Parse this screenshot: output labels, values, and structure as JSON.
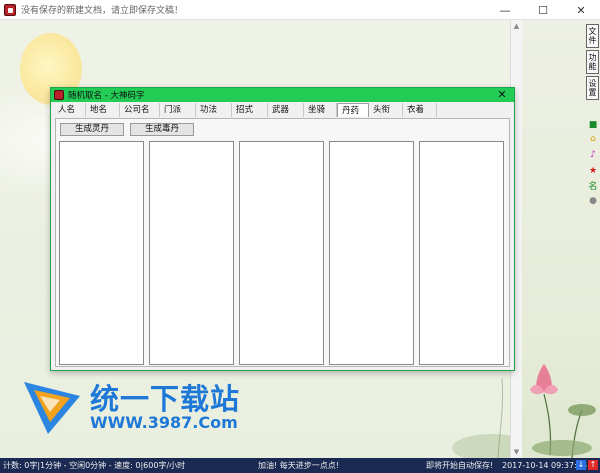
{
  "window": {
    "title": "没有保存的新建文档，请立即保存文稿！",
    "minimize": "—",
    "maximize": "☐",
    "close": "✕"
  },
  "right_toolbar": {
    "tabs": [
      "文件",
      "功能",
      "设置"
    ],
    "icons": [
      "save-icon",
      "lock-icon",
      "music-icon",
      "star-icon",
      "name-icon",
      "pin-icon"
    ]
  },
  "dialog": {
    "title": "随机取名 - 大神码字",
    "close": "✕",
    "tabs": [
      "人名",
      "地名",
      "公司名",
      "门派",
      "功法",
      "招式",
      "武器",
      "坐骑",
      "丹药",
      "头衔",
      "衣着"
    ],
    "active_tab": "丹药",
    "buttons": {
      "generate_spirit_pill": "生成灵丹",
      "generate_poison_pill": "生成毒丹"
    }
  },
  "watermark": {
    "text": "统一下载站",
    "url": "WWW.3987.Com"
  },
  "statusbar": {
    "word_count": "计数: 0字|1分钟 - 空闲0分钟 - 速度: 0|600字/小时",
    "motto": "加油! 每天进步一点点!",
    "autosave": "即将开始自动保存!",
    "datetime": "2017-10-14 09:37:26"
  },
  "colors": {
    "dialog_title_bar": "#22cc55",
    "statusbar_bg": "#1b2a52",
    "watermark_blue": "#1e78d8"
  }
}
